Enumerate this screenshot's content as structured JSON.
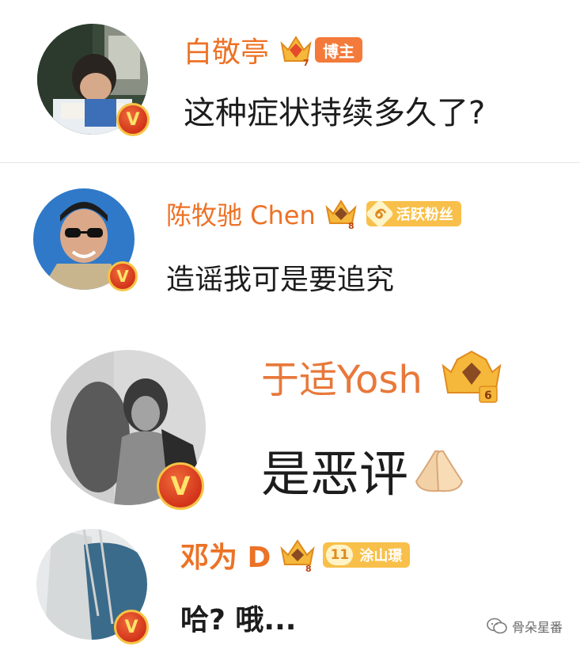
{
  "comments": [
    {
      "name": "白敬亭",
      "role_badge": "博主",
      "crown_level": "7",
      "text": "这种症状持续多久了?"
    },
    {
      "name": "陈牧驰 Chen",
      "crown_level": "8",
      "fan_level": "6",
      "fan_badge": "活跃粉丝",
      "text": "造谣我可是要追究"
    },
    {
      "name": "于适Yosh",
      "crown_level": "6",
      "text": "是恶评"
    },
    {
      "name": "邓为 D",
      "crown_level": "8",
      "fan_level": "11",
      "fan_badge": "涂山璟",
      "text": "哈?  哦..."
    }
  ],
  "verified_mark": "V",
  "watermark": {
    "text": "骨朵星番"
  },
  "colors": {
    "name": "#ec7226",
    "divider": "#e5e5e5",
    "text": "#1c1c1c",
    "badge_orange": "#f5a623"
  }
}
